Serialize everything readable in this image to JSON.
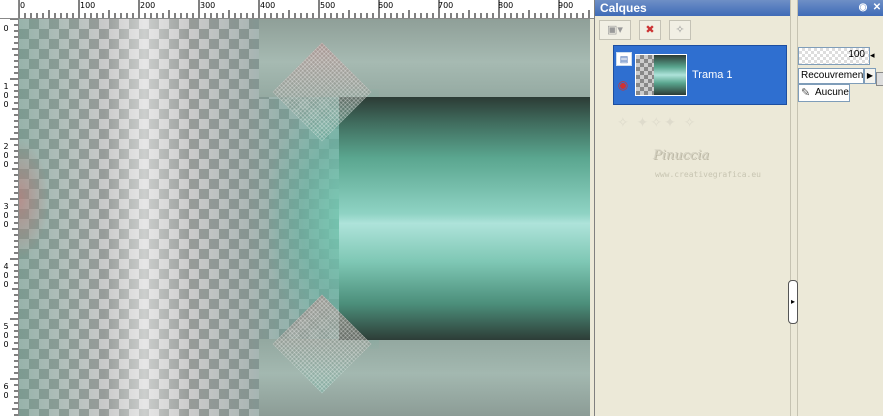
{
  "rulers": {
    "top_labels": [
      "0",
      "100",
      "200",
      "300",
      "400",
      "500",
      "600",
      "700",
      "800",
      "900"
    ],
    "left_labels": [
      "0",
      "1\n0\n0",
      "2\n0\n0",
      "3\n0\n0",
      "4\n0\n0",
      "5\n0\n0",
      "6\n0"
    ]
  },
  "panel": {
    "title": "Calques",
    "pin_icon": "pin-icon",
    "close_icon": "close-icon",
    "toolbar": {
      "new_layer_icon": "new-layer-icon",
      "delete_layer_icon": "delete-layer-icon",
      "mask_icon": "mask-icon"
    },
    "layer": {
      "name": "Trama 1",
      "visible": true
    },
    "watermark": {
      "name": "Pinuccia",
      "url": "www.creativegrafica.eu"
    },
    "properties": {
      "opacity": "100",
      "blend_mode": "Recouvrement",
      "mask": "Aucune"
    }
  }
}
